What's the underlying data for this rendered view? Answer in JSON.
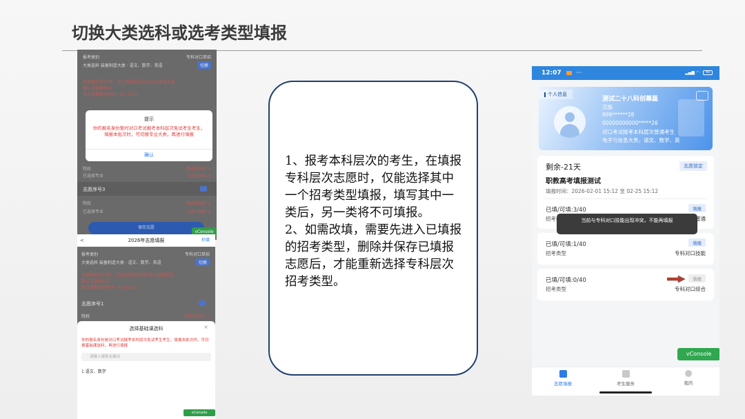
{
  "slide": {
    "title": "切换大类选科或选考类型填报"
  },
  "left_top": {
    "rows": [
      {
        "text": "报考类别",
        "right": "专科对口单招"
      },
      {
        "text": "大类选科 装备制造大类 · 语文、数学、英语",
        "right": "切换"
      },
      {
        "text": "可填报志愿45所，已已填报志愿0所(最大填报志愿",
        "red": true
      },
      {
        "text": "数)2次填报机会",
        "red": true
      },
      {
        "text": "本次填报剩余时间：00:39:21",
        "red": true
      }
    ],
    "dialog": {
      "title": "提示",
      "body": "你的报名身份暂时对口考试报考本科层次免试考生考生，填报本批次时，可切换专业大类，再进行填报",
      "ok": "确认"
    },
    "lower_rows": [
      {
        "text": "院校",
        "right": "请选择院校 >"
      },
      {
        "text": "已选择专业",
        "right": "0/6(必填) >"
      },
      {
        "text": "志愿序号3"
      },
      {
        "text": "院校",
        "right": "请选择院校 >"
      },
      {
        "text": "已选择专业",
        "right": "0/6(必填) >"
      }
    ],
    "save_button": "保存志愿",
    "vconsole": "vConsole"
  },
  "left_bottom": {
    "header_title": "2026年志愿填报",
    "header_back": "<",
    "header_action": "抄填",
    "rows": [
      {
        "text": "报考类别",
        "right": "专科对口单招"
      },
      {
        "text": "大类选科 装备制造大类 · 语文、数学、英语",
        "right": "切换"
      },
      {
        "text": "可填报志愿45所，已已填报志愿0所(最大填报志愿",
        "red": true
      },
      {
        "text": "数)2次填报机会",
        "red": true
      },
      {
        "text": "本次填报剩余时间：00:39:21",
        "red": true
      },
      {
        "text": "志愿序号1"
      },
      {
        "text": "院校",
        "right": "请选择院校 >"
      }
    ],
    "sheet": {
      "title": "选择基础课选科",
      "close": "×",
      "warning": "你的报名身份是对口考试报考本科层次免试考生考生，填报本批次时，可切换基础课选科，再进行填报",
      "search_placeholder": "请输入搜索关键词",
      "item": "1 语文、数学",
      "vconsole": "vConsole"
    }
  },
  "note": {
    "p1": "1、报考本科层次的考生，在填报专科层次志愿时，仅能选择其中一个招考类型填报，填写其中一类后，另一类将不可填报。",
    "p2": "2、如需改填，需要先进入已填报的招考类型，删除并保存已填报志愿后，才能重新选择专科层次招考类型。"
  },
  "phone": {
    "status": {
      "time": "12:07",
      "dots": "···",
      "battery": "40"
    },
    "id_card": {
      "tag": "个人信息",
      "name": "测试二十八科创幕磊",
      "nation": "汉族",
      "id_number": "999******28",
      "exam_number": "00000000000*****26",
      "category": "对口考试报考本科层次普通考生",
      "subjects": "电子与信息大类，语文、数学、英"
    },
    "plan": {
      "remaining": "剩余-21天",
      "lock": "志愿锁定",
      "name": "职教高考填报测试",
      "time": "填报时间：2026-02-01 15:12 至 02-25 15:12"
    },
    "entries": [
      {
        "count": "已填/可填:3/40",
        "label": "招考类型",
        "value": "普通",
        "button": "填报"
      },
      {
        "count": "已填/可填:1/40",
        "label": "招考类型",
        "value": "专科对口技能",
        "button": "填报"
      },
      {
        "count": "已填/可填:0/40",
        "label": "招考类型",
        "value": "专科对口综合",
        "button": "填报"
      }
    ],
    "toast": "当前与专科对口技能出现冲突，不能再填报",
    "vconsole": "vConsole",
    "tabs": [
      {
        "label": "志愿填报"
      },
      {
        "label": "考生服务"
      },
      {
        "label": "我的"
      }
    ],
    "colors": {
      "status_bar": "#2e86de",
      "accent": "#2d7ce6",
      "console": "#2fa84f",
      "arrow": "#c0392b"
    }
  }
}
